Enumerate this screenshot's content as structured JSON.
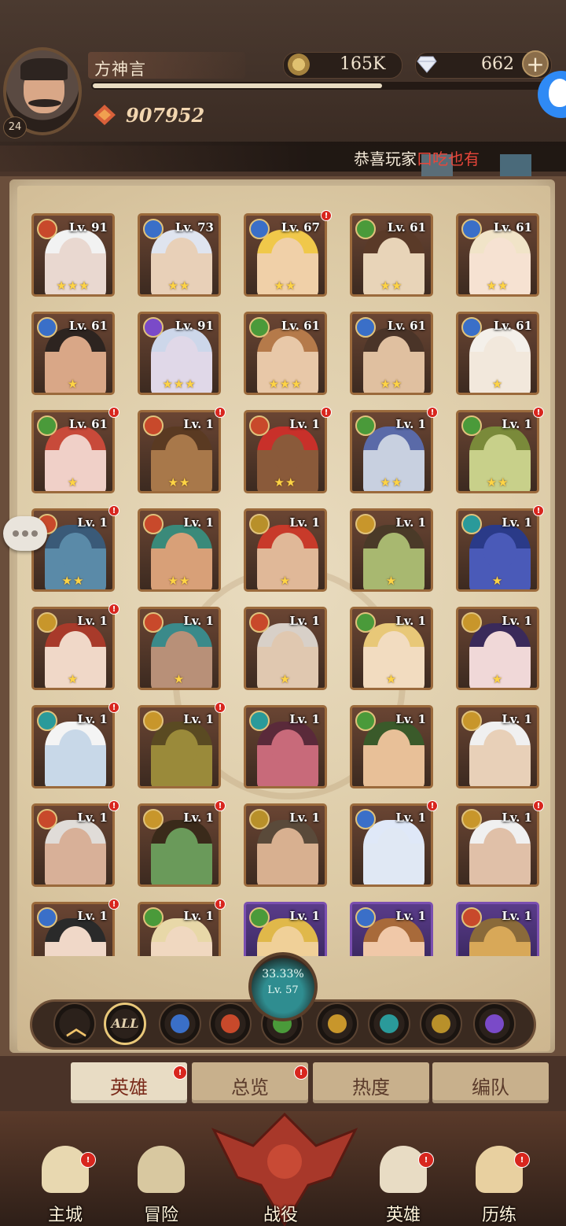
{
  "player": {
    "name": "方神言",
    "level": "24",
    "power": "907952"
  },
  "resources": {
    "gold": "165K",
    "gems": "662",
    "add_label": "+"
  },
  "marquee": {
    "prefix": "恭喜玩家",
    "name": "口吃也有"
  },
  "colors": {
    "fire": "#c8492b",
    "water": "#3a6fc8",
    "nature": "#4a9a3a",
    "light": "#c8962b",
    "void": "#7a4ac8",
    "wind": "#2a9a9a",
    "sun": "#b8902a"
  },
  "heroes": [
    {
      "lv": "Lv. 91",
      "stars": "★★★",
      "faction": "fire",
      "alert": false,
      "rarity": "normal",
      "skin": "#e9d8d0",
      "hair": "#f2f2f2"
    },
    {
      "lv": "Lv. 73",
      "stars": "★★",
      "faction": "water",
      "alert": false,
      "rarity": "normal",
      "skin": "#e8d0b8",
      "hair": "#dfe4ef"
    },
    {
      "lv": "Lv. 67",
      "stars": "★★",
      "faction": "water",
      "alert": true,
      "rarity": "normal",
      "skin": "#f0d0a8",
      "hair": "#f0c84a"
    },
    {
      "lv": "Lv. 61",
      "stars": "★★",
      "faction": "nature",
      "alert": false,
      "rarity": "normal",
      "skin": "#e8d4b8",
      "hair": "#5a3a28"
    },
    {
      "lv": "Lv. 61",
      "stars": "★★",
      "faction": "water",
      "alert": false,
      "rarity": "normal",
      "skin": "#f6e2d2",
      "hair": "#f1e4c8"
    },
    {
      "lv": "Lv. 61",
      "stars": "★",
      "faction": "water",
      "alert": false,
      "rarity": "normal",
      "skin": "#d9a787",
      "hair": "#2d2420"
    },
    {
      "lv": "Lv. 91",
      "stars": "★★★",
      "faction": "void",
      "alert": false,
      "rarity": "normal",
      "skin": "#e0d8e8",
      "hair": "#cdd7ea"
    },
    {
      "lv": "Lv. 61",
      "stars": "★★★",
      "faction": "nature",
      "alert": false,
      "rarity": "normal",
      "skin": "#e8c8a8",
      "hair": "#b57a4a"
    },
    {
      "lv": "Lv. 61",
      "stars": "★★",
      "faction": "water",
      "alert": false,
      "rarity": "normal",
      "skin": "#e0c0a0",
      "hair": "#4a3428"
    },
    {
      "lv": "Lv. 61",
      "stars": "★",
      "faction": "water",
      "alert": false,
      "rarity": "normal",
      "skin": "#f2e8dc",
      "hair": "#f4f0ea"
    },
    {
      "lv": "Lv. 61",
      "stars": "★",
      "faction": "nature",
      "alert": true,
      "rarity": "normal",
      "skin": "#f0d0c8",
      "hair": "#c84a3a"
    },
    {
      "lv": "Lv. 1",
      "stars": "★★",
      "faction": "fire",
      "alert": true,
      "rarity": "normal",
      "skin": "#a8784a",
      "hair": "#5a3a22"
    },
    {
      "lv": "Lv. 1",
      "stars": "★★",
      "faction": "fire",
      "alert": true,
      "rarity": "normal",
      "skin": "#8a5a3a",
      "hair": "#c8302a"
    },
    {
      "lv": "Lv. 1",
      "stars": "★★",
      "faction": "nature",
      "alert": true,
      "rarity": "normal",
      "skin": "#c8d0e0",
      "hair": "#5a6aa8"
    },
    {
      "lv": "Lv. 1",
      "stars": "★★",
      "faction": "nature",
      "alert": true,
      "rarity": "normal",
      "skin": "#c8d08a",
      "hair": "#7a8a3a"
    },
    {
      "lv": "Lv. 1",
      "stars": "★★",
      "faction": "fire",
      "alert": true,
      "rarity": "normal",
      "skin": "#5a8aa8",
      "hair": "#3a5a78"
    },
    {
      "lv": "Lv. 1",
      "stars": "★★",
      "faction": "fire",
      "alert": false,
      "rarity": "normal",
      "skin": "#d8a078",
      "hair": "#3a8a7a"
    },
    {
      "lv": "Lv. 1",
      "stars": "★",
      "faction": "sun",
      "alert": false,
      "rarity": "normal",
      "skin": "#e0b898",
      "hair": "#c83a2a"
    },
    {
      "lv": "Lv. 1",
      "stars": "★",
      "faction": "light",
      "alert": false,
      "rarity": "normal",
      "skin": "#a8b870",
      "hair": "#4a3a28"
    },
    {
      "lv": "Lv. 1",
      "stars": "★",
      "faction": "wind",
      "alert": true,
      "rarity": "normal",
      "skin": "#4a5ab8",
      "hair": "#2a3a88"
    },
    {
      "lv": "Lv. 1",
      "stars": "★",
      "faction": "light",
      "alert": true,
      "rarity": "normal",
      "skin": "#f0d8c8",
      "hair": "#a83a2a"
    },
    {
      "lv": "Lv. 1",
      "stars": "★",
      "faction": "fire",
      "alert": false,
      "rarity": "normal",
      "skin": "#b89078",
      "hair": "#3a8a8a"
    },
    {
      "lv": "Lv. 1",
      "stars": "★",
      "faction": "fire",
      "alert": false,
      "rarity": "normal",
      "skin": "#e0c8b0",
      "hair": "#d8d0c8"
    },
    {
      "lv": "Lv. 1",
      "stars": "★",
      "faction": "nature",
      "alert": false,
      "rarity": "normal",
      "skin": "#f2dcc0",
      "hair": "#e8c878"
    },
    {
      "lv": "Lv. 1",
      "stars": "★",
      "faction": "light",
      "alert": false,
      "rarity": "normal",
      "skin": "#f0d8d8",
      "hair": "#3a2a5a"
    },
    {
      "lv": "Lv. 1",
      "stars": "",
      "faction": "wind",
      "alert": true,
      "rarity": "normal",
      "skin": "#c8d8e8",
      "hair": "#f4f4f4"
    },
    {
      "lv": "Lv. 1",
      "stars": "",
      "faction": "light",
      "alert": true,
      "rarity": "normal",
      "skin": "#9a8a3a",
      "hair": "#5a4a22"
    },
    {
      "lv": "Lv. 1",
      "stars": "",
      "faction": "wind",
      "alert": false,
      "rarity": "normal",
      "skin": "#c86a7a",
      "hair": "#5a2a3a"
    },
    {
      "lv": "Lv. 1",
      "stars": "",
      "faction": "nature",
      "alert": false,
      "rarity": "normal",
      "skin": "#e8c098",
      "hair": "#3a5a2a"
    },
    {
      "lv": "Lv. 1",
      "stars": "",
      "faction": "light",
      "alert": false,
      "rarity": "normal",
      "skin": "#e8d0b8",
      "hair": "#f0f0f0"
    },
    {
      "lv": "Lv. 1",
      "stars": "",
      "faction": "fire",
      "alert": true,
      "rarity": "normal",
      "skin": "#d8b098",
      "hair": "#e0dcd8"
    },
    {
      "lv": "Lv. 1",
      "stars": "",
      "faction": "light",
      "alert": true,
      "rarity": "normal",
      "skin": "#6a9a5a",
      "hair": "#3a2a1a"
    },
    {
      "lv": "Lv. 1",
      "stars": "",
      "faction": "sun",
      "alert": false,
      "rarity": "normal",
      "skin": "#d8b090",
      "hair": "#5a4a3a"
    },
    {
      "lv": "Lv. 1",
      "stars": "",
      "faction": "water",
      "alert": true,
      "rarity": "normal",
      "skin": "#e0e8f4",
      "hair": "#dfe8f8"
    },
    {
      "lv": "Lv. 1",
      "stars": "",
      "faction": "light",
      "alert": true,
      "rarity": "normal",
      "skin": "#e0c0a8",
      "hair": "#f0f0f0"
    },
    {
      "lv": "Lv. 1",
      "stars": "",
      "faction": "water",
      "alert": true,
      "rarity": "normal",
      "skin": "#f0d8c8",
      "hair": "#2a2a2a"
    },
    {
      "lv": "Lv. 1",
      "stars": "",
      "faction": "nature",
      "alert": true,
      "rarity": "normal",
      "skin": "#f0d8c0",
      "hair": "#e8d8a8"
    },
    {
      "lv": "Lv. 1",
      "stars": "",
      "faction": "nature",
      "alert": false,
      "rarity": "epic",
      "skin": "#f0d098",
      "hair": "#e0b84a"
    },
    {
      "lv": "Lv. 1",
      "stars": "",
      "faction": "water",
      "alert": false,
      "rarity": "epic",
      "skin": "#f0c8a8",
      "hair": "#a86a3a"
    },
    {
      "lv": "Lv. 1",
      "stars": "",
      "faction": "fire",
      "alert": false,
      "rarity": "epic",
      "skin": "#d8a858",
      "hair": "#8a6a3a"
    }
  ],
  "collection": {
    "percent": "33.33%",
    "level": "Lv. 57"
  },
  "filters": [
    {
      "id": "collapse",
      "label": ""
    },
    {
      "id": "all",
      "label": "ALL"
    },
    {
      "id": "water",
      "label": ""
    },
    {
      "id": "fire",
      "label": ""
    },
    {
      "id": "nature",
      "label": ""
    },
    {
      "id": "light",
      "label": ""
    },
    {
      "id": "wind",
      "label": ""
    },
    {
      "id": "sun",
      "label": ""
    },
    {
      "id": "void",
      "label": ""
    }
  ],
  "tabs": [
    {
      "label": "英雄",
      "active": true,
      "alert": true
    },
    {
      "label": "总览",
      "active": false,
      "alert": true
    },
    {
      "label": "热度",
      "active": false,
      "alert": false
    },
    {
      "label": "编队",
      "active": false,
      "alert": false
    }
  ],
  "nav": [
    {
      "label": "主城",
      "icon": "castle-icon",
      "alert": true
    },
    {
      "label": "冒险",
      "icon": "map-scroll-icon",
      "alert": false
    },
    {
      "label": "战役",
      "icon": "dragon-icon",
      "alert": false
    },
    {
      "label": "英雄",
      "icon": "hero-icon",
      "alert": true
    },
    {
      "label": "历练",
      "icon": "training-icon",
      "alert": true
    }
  ]
}
